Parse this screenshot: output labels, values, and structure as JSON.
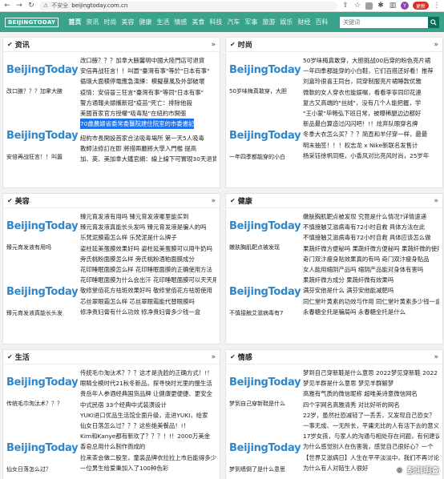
{
  "browser": {
    "security": "不安全",
    "url": "beijingtoday.com.cn",
    "profile_initial": "Y",
    "update_label": "更新"
  },
  "site": {
    "logo": "BEIJINGTODAY",
    "nav": [
      "首页",
      "资讯",
      "时尚",
      "美容",
      "健康",
      "生活",
      "情感",
      "美食",
      "科技",
      "汽车",
      "军事",
      "旅游",
      "娱乐",
      "财经",
      "百科"
    ],
    "search_placeholder": "关键词"
  },
  "panels": [
    {
      "title": "资讯",
      "thumbs": [
        {
          "logo": "BeijingToday",
          "caption": "改口腋？？？加拿大腋"
        },
        {
          "logo": "BeijingToday",
          "caption": "安倍再战狂言！！叫嚣"
        }
      ],
      "items": [
        "改口腋？？？加拿大腋馨明中國大陸門店可退貨",
        "安倍再战狂言！！叫嚣\"臺灣有事\"等於\"日本有事\"",
        "循環大面積停電應急演練：模擬暴風及外部破壞",
        "疫情：安倍晉三狂言\"臺灣有事\"等同\"日本有事\"",
        "警方通報夫婦攜新冠\"疫苗\"死亡：排除他殺",
        "美國首家官方授權\"吸毒點\"在紐約市開張",
        "70歲農婦省委常委醫院建住院室的市委書記",
        "紐約市長開設首家合法吸毒場所 第一天5人吸毒",
        "教師法修訂在即 將措兩廳將大學入門檻 提高",
        "加、英、美加拿大鐵官網：線上線下可實現30天退貨"
      ],
      "highlight_index": 6
    },
    {
      "title": "时尚",
      "thumbs": [
        {
          "logo": "BeijingToday",
          "caption": "50岁味梅真敢穿，大胆"
        },
        {
          "logo": "BeijingToday",
          "caption": "一年四季都能穿的小白"
        }
      ],
      "items": [
        "50岁味梅真敢穿，大胆挑战00后穿的粉色亮片裙",
        "一年四季都能穿的小白鞋，它们百搭还好看！推荐",
        "刘嘉玲很喜王同台，同穿制服亮片裙睡款优雅",
        "微軟的女人穿衣也能娱嘱，看看李寧同印花連",
        "复古又高端的\"丝绒\"，没有几个人能把握，学",
        "\"王小蒙\"毕畅弘下班日常，被曝稀腿边边都好",
        "新品最白算造过闪闪吧！!！炫弃队眼穿名牌",
        "冬季大衣怎么买？？？简直和羊仔穿一样，最最",
        "明末抽签！！！权志龙 x Nike新联名发售计",
        "杨采钰徐帆同框，小香风对比亮风时尚，25岁年"
      ],
      "highlight_index": -1
    },
    {
      "title": "美容",
      "thumbs": [
        {
          "logo": "BeijingToday",
          "caption": "臻元育发液有用吗"
        },
        {
          "logo": "BeijingToday",
          "caption": "臻元育发液真能长头发"
        }
      ],
      "items": [
        "臻元育发液有用吗 臻元育发液哪里能买到",
        "臻元育发液真能长头发吗 臻元育发液是骗人的吗",
        "乐梵泥膜霜怎么样 乐梵泥是什么牌子",
        "姿柱延美蛋膜效果好吗 姿柱延美蛋膜可以用牛奶吗",
        "旁氏桃粉面膜怎么样 旁氏桃粉酒粕面膜成分",
        "花印睡眠面膜怎么样 花印睡眠面膜的正确使用方法",
        "花印睡眠面膜为什么会出汗 花印睡眠面膜可以天天用吗",
        "敬修堂佰花方祛斑效果好吗 敬修堂佰花方祛斑使用",
        "芯丝翠眼霜怎么样 芯丝翠眼霜能代替眼膜吗",
        "修净贵妇膏有什么功效 修净贵妇膏多少钱一盒"
      ],
      "highlight_index": -1
    },
    {
      "title": "健康",
      "thumbs": [
        {
          "logo": "BeijingToday",
          "caption": "嫩肤胸肌靶点被发现"
        },
        {
          "logo": "BeijingToday",
          "caption": "不慎接触艾滋病毒有7"
        }
      ],
      "items": [
        "嫩肤胸肌靶点被发现 究竟是什么情况?详情速递",
        "不慎接触艾滋病毒有72小时自救 具体方法在此",
        "不慎接触艾滋病毒有72小时自救 具体应该怎么做",
        "果蔬纤微方便秘吗 果蔬纤微方便秘吗 果蔬纤微的使用方法",
        "奇门双汴瘦身贴效果真的有吗 奇门双汴瘦身贴品",
        "女人能用缩阴产品吗 缩阴产品能对身体有害吗",
        "果蔬纤微方成分 果蔬纤微有效果吗",
        "满芬安他是什么 满芬安他能减肥吗",
        "同仁堂叶黄素的功效与作用 同仁堂叶黄素多少钱一盒",
        "永春糖全托是骗局吗 永春糖全托是什么"
      ],
      "highlight_index": -1
    },
    {
      "title": "生活",
      "thumbs": [
        {
          "logo": "BeijingToday",
          "caption": "传统毛巾淘汰术？？？"
        },
        {
          "logo": "BeijingToday",
          "caption": "仙女日落怎么过？"
        }
      ],
      "items": [
        "传统毛巾淘汰术？？？这才是洗脸的正确方式！!！",
        "眼睛全模时代21秋冬新品，探寻快时光里的慢生活",
        "贵岳年人参酒经典国货品牌 让健康更便捷、更安全",
        "中式民宿 33个经典中式装潢设计",
        "YUKI进口优品生活馆全面升级，走进YUKI，给家",
        "仙女日落怎么过？？？这些绝美餐品！!！",
        "Kim和Kanye都有新欢了？？？！!！2000万美金",
        "香皂总用什么制作而成的",
        "拉来茶会做二股至，童装品牌衣拉拉上市后能得多少",
        "一位男生给爱秉加入了100种色彩"
      ],
      "highlight_index": -1
    },
    {
      "title": "情感",
      "thumbs": [
        {
          "logo": "BeijingToday",
          "caption": "梦到自己穿新鞋是什么"
        },
        {
          "logo": "BeijingToday",
          "caption": "梦到墙倒了是什么意思"
        }
      ],
      "items": [
        "梦到自己穿新鞋是什么意思 2022梦见穿新鞋 2022",
        "梦见羊群是什么意思 梦见羊群解梦",
        "高雅有气质的微信昵称 超唯美诗意微信网名",
        "四个字网名高雅清秀 对比好听的网名",
        "22岁，虽然社恐减轻了一丢丢，又发现自己恐女？",
        "一事无成、一无所长，平庸无比的人有活下去的意义",
        "17岁女孩，与家人的沟通与相处存在问题，有何建议",
        "为什么感觉别人在伤害我，感觉自己很好心？一个",
        "【世界艾滋病日】人生在平平淡淡中，我们不再讨论",
        "为什么有人对陌生人很好"
      ],
      "highlight_index": -1
    }
  ],
  "watermark": "彭湃明查"
}
